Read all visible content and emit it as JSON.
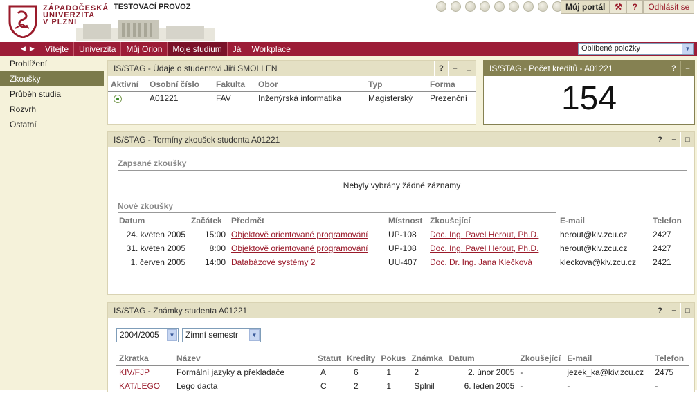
{
  "header": {
    "logo_lines": [
      "ZÁPADOČESKÁ",
      "UNIVERZITA",
      "V PLZNI"
    ],
    "test_mode": "TESTOVACÍ PROVOZ",
    "portal_button": "Můj portál",
    "tools_icon": "wrench-icon",
    "help_label": "?",
    "logout_label": "Odhlásit se"
  },
  "nav": {
    "items": [
      "Vítejte",
      "Univerzita",
      "Můj Orion",
      "Moje studium",
      "Já",
      "Workplace"
    ],
    "active_index": 3,
    "favorites_select": "Oblíbené položky"
  },
  "sidebar": {
    "items": [
      "Prohlížení",
      "Zkoušky",
      "Průběh studia",
      "Rozvrh",
      "Ostatní"
    ],
    "active_index": 1
  },
  "student_portlet": {
    "title": "IS/STAG - Údaje o studentovi Jiří SMOLLEN",
    "columns": [
      "Aktivní",
      "Osobní číslo",
      "Fakulta",
      "Obor",
      "Typ",
      "Forma"
    ],
    "row": {
      "osobni_cislo": "A01221",
      "fakulta": "FAV",
      "obor": "Inženýrská informatika",
      "typ": "Magisterský",
      "forma": "Prezenční"
    }
  },
  "credits_portlet": {
    "title": "IS/STAG - Počet kreditů - A01221",
    "value": "154"
  },
  "exams_portlet": {
    "title": "IS/STAG - Termíny zkoušek studenta A01221",
    "registered_heading": "Zapsané zkoušky",
    "no_records": "Nebyly vybrány žádné záznamy",
    "new_heading": "Nové zkoušky",
    "columns": [
      "Datum",
      "Začátek",
      "Předmět",
      "Místnost",
      "Zkoušející",
      "E-mail",
      "Telefon"
    ],
    "rows": [
      [
        "24. květen 2005",
        "15:00",
        "Objektově orientované programování",
        "UP-108",
        "Doc. Ing. Pavel Herout, Ph.D.",
        "herout@kiv.zcu.cz",
        "2427"
      ],
      [
        "31. květen 2005",
        "8:00",
        "Objektově orientované programování",
        "UP-108",
        "Doc. Ing. Pavel Herout, Ph.D.",
        "herout@kiv.zcu.cz",
        "2427"
      ],
      [
        "1. červen 2005",
        "14:00",
        "Databázové systémy 2",
        "UU-407",
        "Doc. Dr. Ing. Jana Klečková",
        "kleckova@kiv.zcu.cz",
        "2421"
      ]
    ]
  },
  "grades_portlet": {
    "title": "IS/STAG - Známky studenta A01221",
    "year_select": "2004/2005",
    "semester_select": "Zimní semestr",
    "columns": [
      "Zkratka",
      "Název",
      "Statut",
      "Kredity",
      "Pokus",
      "Známka",
      "Datum",
      "Zkoušející",
      "E-mail",
      "Telefon"
    ],
    "rows": [
      [
        "KIV/FJP",
        "Formální jazyky a překladače",
        "A",
        "6",
        "1",
        "2",
        "2. únor 2005",
        "-",
        "jezek_ka@kiv.zcu.cz",
        "2475"
      ],
      [
        "KAT/LEGO",
        "Lego dacta",
        "C",
        "2",
        "1",
        "Splnil",
        "6. leden 2005",
        "-",
        "-",
        "-"
      ]
    ]
  },
  "portlet_buttons": {
    "help": "?",
    "minimize": "–",
    "maximize": "□"
  }
}
